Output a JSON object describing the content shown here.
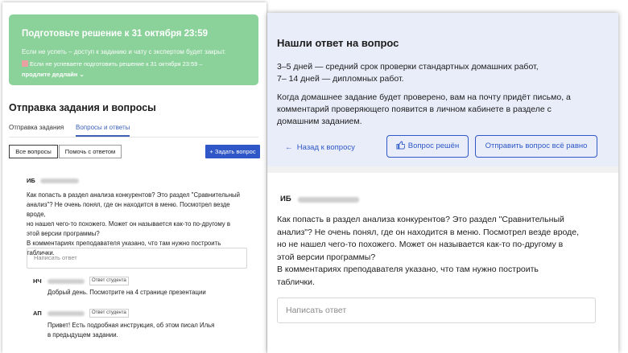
{
  "left": {
    "banner": {
      "title": "Подготовьте решение к 31 октября 23:59",
      "line1": "Если не успеть – доступ к заданию и чату с экспертом будет закрыт.",
      "line2": "Если не успеваете подготовить решение к 31 октября 23:59 –",
      "link": "продлите дедлайн"
    },
    "heading": "Отправка задания и вопросы",
    "tabs": [
      "Отправка задания",
      "Вопросы и ответы"
    ],
    "filters": [
      "Все вопросы",
      "Помочь с ответом"
    ],
    "ask_button": "+ Задать вопрос",
    "question": {
      "initials": "ИБ",
      "text": [
        "Как попасть в раздел анализа конкурентов? Это раздел \"Сравнительный",
        "анализ\"? Не очень понял, где он находится в меню. Посмотрел везде вроде,",
        "но нашел чего-то похожего. Может он называется как-то по-другому в",
        "этой версии программы?",
        "В комментариях преподавателя указано, что там нужно построить",
        "таблички."
      ]
    },
    "answer_placeholder": "Написать ответ",
    "replies": [
      {
        "initials": "НЧ",
        "badge": "Ответ студента",
        "lines": [
          "Добрый день. Посмотрите на 4 странице презентации"
        ]
      },
      {
        "initials": "АП",
        "badge": "Ответ студента",
        "lines": [
          "Привет! Есть подробная инструкция, об этом писал Илья",
          "в предыдущем задании."
        ]
      }
    ]
  },
  "right": {
    "found_title": "Нашли ответ на вопрос",
    "para1": [
      "3–5 дней — средний срок проверки стандартных домашних работ,",
      "7– 14 дней — дипломных работ."
    ],
    "para2": [
      "Когда домашнее задание будет проверено, вам на почту придёт письмо, а",
      "комментарий проверяющего появится в личном кабинете в разделе с",
      "домашним заданием."
    ],
    "back_link": "Назад к вопросу",
    "resolved_button": "Вопрос решён",
    "send_button": "Отправить вопрос всё равно",
    "question": {
      "initials": "ИБ",
      "text": [
        "Как попасть в раздел анализа конкурентов? Это раздел \"Сравнительный",
        "анализ\"? Не очень понял, где он находится в меню. Посмотрел везде вроде,",
        "но не нашел чего-то похожего. Может он называется как-то по-другому в",
        "этой версии программы?",
        "В комментариях преподавателя указано, что там нужно построить",
        "таблички."
      ]
    },
    "answer_placeholder": "Написать ответ"
  },
  "colors": {
    "banner": "#8bd19a",
    "accent": "#2f57c7",
    "card": "#e8edf9"
  },
  "icons": [
    "chevron-down-icon",
    "calendar-icon",
    "arrow-left-icon",
    "thumbs-up-icon"
  ]
}
